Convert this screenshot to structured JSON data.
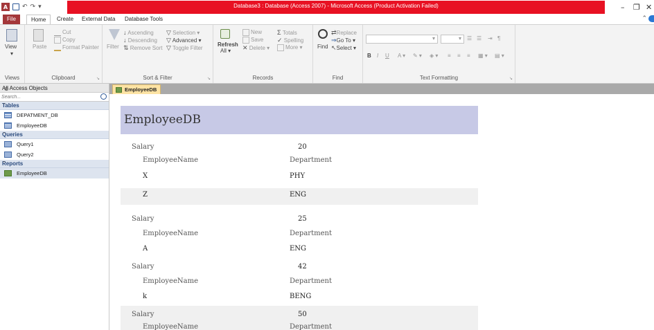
{
  "window": {
    "title": "Database3 : Database (Access 2007) - Microsoft Access (Product Activation Failed)",
    "app_logo_letter": "A"
  },
  "menu_tabs": [
    {
      "label": "File"
    },
    {
      "label": "Home"
    },
    {
      "label": "Create"
    },
    {
      "label": "External Data"
    },
    {
      "label": "Database Tools"
    }
  ],
  "ribbon": {
    "views": {
      "view_label": "View",
      "group_label": "Views"
    },
    "clipboard": {
      "paste": "Paste",
      "cut": "Cut",
      "copy": "Copy",
      "format_painter": "Format Painter",
      "group_label": "Clipboard"
    },
    "sort_filter": {
      "filter": "Filter",
      "ascending": "Ascending",
      "descending": "Descending",
      "remove_sort": "Remove Sort",
      "selection": "Selection",
      "advanced": "Advanced",
      "toggle_filter": "Toggle Filter",
      "group_label": "Sort & Filter"
    },
    "records": {
      "refresh": "Refresh",
      "refresh_all": "All",
      "new": "New",
      "save": "Save",
      "delete": "Delete",
      "totals": "Totals",
      "spelling": "Spelling",
      "more": "More",
      "group_label": "Records"
    },
    "find": {
      "find": "Find",
      "replace": "Replace",
      "go_to": "Go To",
      "select": "Select",
      "group_label": "Find"
    },
    "text_formatting": {
      "group_label": "Text Formatting"
    }
  },
  "nav_pane": {
    "header": "All Access Objects",
    "search_placeholder": "Search...",
    "sections": [
      {
        "title": "Tables",
        "items": [
          "DEPATMENT_DB",
          "EmployeeDB"
        ]
      },
      {
        "title": "Queries",
        "items": [
          "Query1",
          "Query2"
        ]
      },
      {
        "title": "Reports",
        "items": [
          "EmployeeDB"
        ]
      }
    ]
  },
  "document": {
    "tab_label": "EmployeeDB",
    "report_title": "EmployeeDB",
    "labels": {
      "salary": "Salary",
      "employee_name": "EmployeeName",
      "department": "Department"
    },
    "groups": [
      {
        "salary": "20",
        "rows": [
          {
            "name": "X",
            "dept": "PHY"
          },
          {
            "name": "Z",
            "dept": "ENG"
          }
        ]
      },
      {
        "salary": "25",
        "rows": [
          {
            "name": "A",
            "dept": "ENG"
          }
        ]
      },
      {
        "salary": "42",
        "rows": [
          {
            "name": "k",
            "dept": "BENG"
          }
        ]
      },
      {
        "salary": "50",
        "rows": []
      }
    ]
  },
  "colors": {
    "title_bar": "#e81123",
    "file_tab": "#a4373a",
    "report_header": "#c7c9e6",
    "doc_tab": "#fde3a4"
  }
}
